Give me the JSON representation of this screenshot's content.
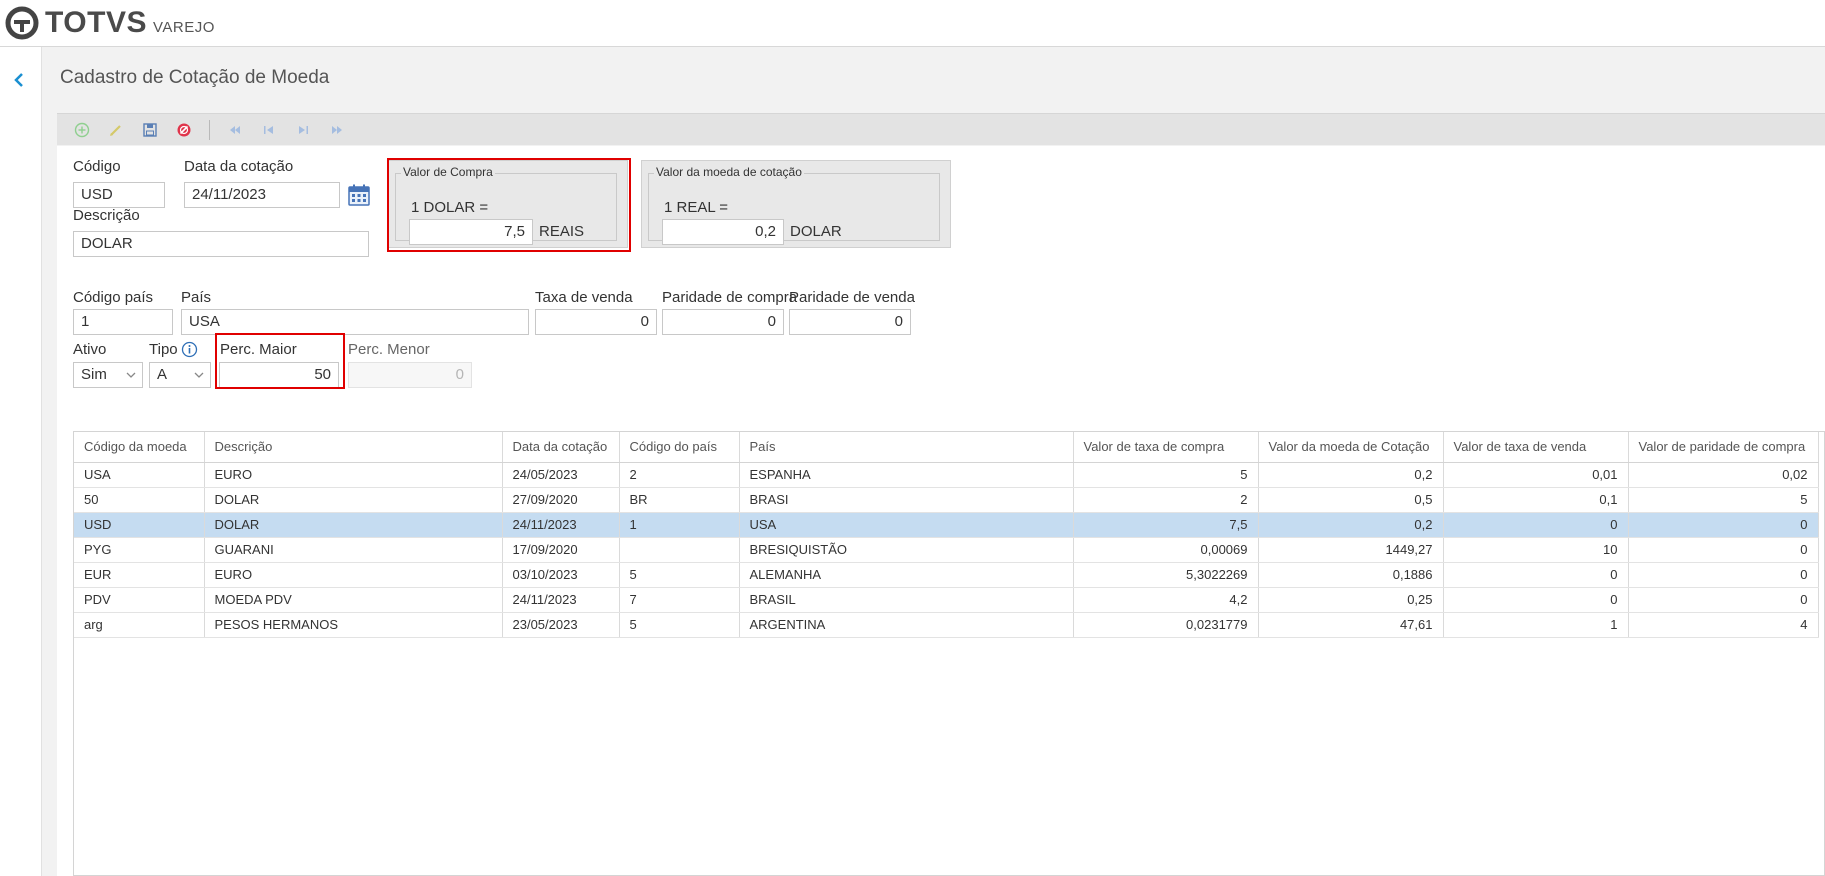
{
  "header": {
    "brand": "TOTVS",
    "product": "VAREJO"
  },
  "page": {
    "title": "Cadastro de Cotação de Moeda"
  },
  "toolbar": {
    "icons": [
      "add-icon",
      "edit-icon",
      "save-icon",
      "cancel-icon",
      "first-record-icon",
      "previous-record-icon",
      "next-record-icon",
      "last-record-icon"
    ]
  },
  "form": {
    "codigo_label": "Código",
    "codigo_value": "USD",
    "data_label": "Data da cotação",
    "data_value": "24/11/2023",
    "descricao_label": "Descrição",
    "descricao_value": "DOLAR",
    "valor_compra": {
      "title": "Valor de Compra",
      "text": "1 DOLAR =",
      "value": "7,5",
      "unit": "REAIS"
    },
    "valor_moeda": {
      "title": "Valor da moeda de cotação",
      "text": "1 REAL =",
      "value": "0,2",
      "unit": "DOLAR"
    },
    "codigo_pais_label": "Código país",
    "codigo_pais_value": "1",
    "pais_label": "País",
    "pais_value": "USA",
    "taxa_venda_label": "Taxa de venda",
    "taxa_venda_value": "0",
    "paridade_compra_label": "Paridade de compra",
    "paridade_compra_value": "0",
    "paridade_venda_label": "Paridade de venda",
    "paridade_venda_value": "0",
    "ativo_label": "Ativo",
    "ativo_value": "Sim",
    "tipo_label": "Tipo",
    "tipo_value": "A",
    "perc_maior_label": "Perc. Maior",
    "perc_maior_value": "50",
    "perc_menor_label": "Perc. Menor",
    "perc_menor_value": "0"
  },
  "grid": {
    "columns": [
      "Código da moeda",
      "Descrição",
      "Data da cotação",
      "Código do país",
      "País",
      "Valor de taxa de compra",
      "Valor da moeda de Cotação",
      "Valor de taxa de venda",
      "Valor de paridade de compra"
    ],
    "rows": [
      [
        "USA",
        "EURO",
        "24/05/2023",
        "2",
        "ESPANHA",
        "5",
        "0,2",
        "0,01",
        "0,02"
      ],
      [
        "50",
        "DOLAR",
        "27/09/2020",
        "BR",
        "BRASI",
        "2",
        "0,5",
        "0,1",
        "5"
      ],
      [
        "USD",
        "DOLAR",
        "24/11/2023",
        "1",
        "USA",
        "7,5",
        "0,2",
        "0",
        "0"
      ],
      [
        "PYG",
        "GUARANI",
        "17/09/2020",
        "",
        "BRESIQUISTÃO",
        "0,00069",
        "1449,27",
        "10",
        "0"
      ],
      [
        "EUR",
        "EURO",
        "03/10/2023",
        "5",
        "ALEMANHA",
        "5,3022269",
        "0,1886",
        "0",
        "0"
      ],
      [
        "PDV",
        "MOEDA PDV",
        "24/11/2023",
        "7",
        "BRASIL",
        "4,2",
        "0,25",
        "0",
        "0"
      ],
      [
        "arg",
        "PESOS HERMANOS",
        "23/05/2023",
        "5",
        "ARGENTINA",
        "0,0231779",
        "47,61",
        "1",
        "4"
      ]
    ],
    "selected_row": 2
  },
  "colors": {
    "accent": "#1a8fd1",
    "highlight": "#e00000",
    "selected_row": "#c5dcf1"
  }
}
